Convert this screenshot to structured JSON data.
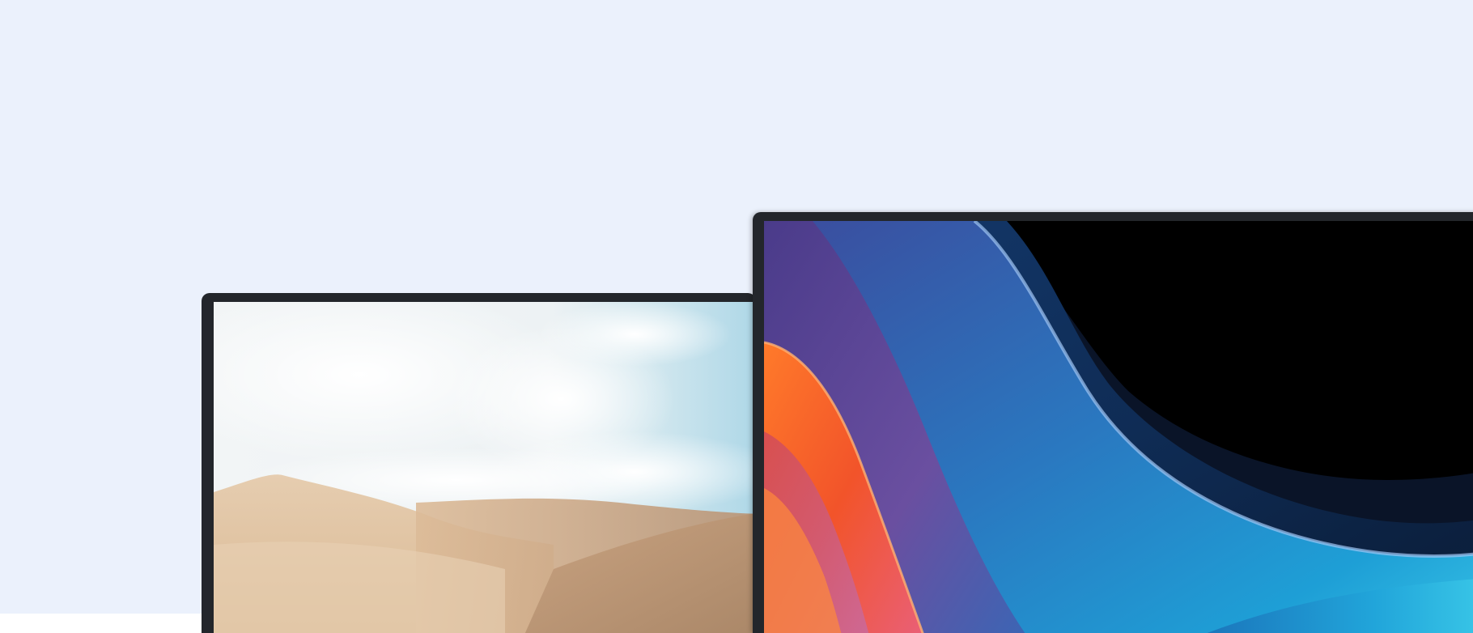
{
  "colors": {
    "background": "#ebf1fc",
    "bezel": "#23262b",
    "desert_sky": "#eef4f6",
    "desert_sky_blue": "#b9dbe8",
    "desert_sand_light": "#ead2b6",
    "desert_sand_dark": "#c4a07e",
    "wave_black": "#000000",
    "wave_navy": "#10305a",
    "wave_blue": "#1f6fb0",
    "wave_cyan": "#33c1e3",
    "wave_purple": "#5b3a8e",
    "wave_orange": "#ff6a2a",
    "wave_pink": "#e9607a"
  },
  "displays": [
    {
      "name": "left-display",
      "wallpaper": "desert-dunes"
    },
    {
      "name": "right-display",
      "wallpaper": "abstract-waves"
    }
  ]
}
